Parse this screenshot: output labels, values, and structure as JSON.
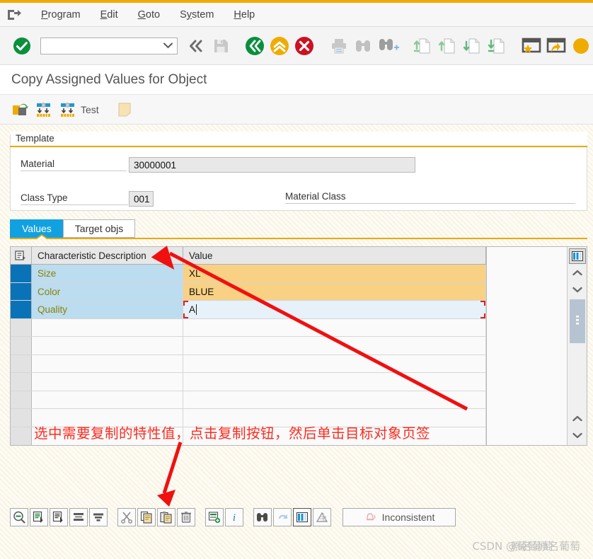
{
  "window": {
    "menu_items": [
      {
        "label": "Program",
        "accel": "P"
      },
      {
        "label": "Edit",
        "accel": "E"
      },
      {
        "label": "Goto",
        "accel": "G"
      },
      {
        "label": "System",
        "accel": "y"
      },
      {
        "label": "Help",
        "accel": "H"
      }
    ],
    "system_menu_icon": "system-menu-icon"
  },
  "toolbar": {
    "command_field_value": "",
    "command_field_placeholder": "",
    "buttons": [
      {
        "name": "enter-check-button",
        "icon": "green-check-icon",
        "title": "Enter"
      },
      {
        "name": "command-dropdown-button",
        "icon": "chevron-down-icon",
        "title": "Command field"
      },
      {
        "name": "back-double-button",
        "icon": "double-chevron-left-icon",
        "title": "Back"
      },
      {
        "name": "save-button",
        "icon": "floppy-disk-icon",
        "title": "Save"
      },
      {
        "name": "back-button",
        "icon": "green-back-icon",
        "title": "Back"
      },
      {
        "name": "exit-button",
        "icon": "yellow-up-icon",
        "title": "Exit"
      },
      {
        "name": "cancel-button",
        "icon": "red-cancel-icon",
        "title": "Cancel"
      },
      {
        "name": "print-button",
        "icon": "printer-icon",
        "title": "Print"
      },
      {
        "name": "find-button",
        "icon": "binoculars-icon",
        "title": "Find"
      },
      {
        "name": "find-next-button",
        "icon": "binoculars-plus-icon",
        "title": "Find Next"
      },
      {
        "name": "first-page-button",
        "icon": "page-first-icon",
        "title": "First Page"
      },
      {
        "name": "previous-page-button",
        "icon": "page-up-icon",
        "title": "Previous Page"
      },
      {
        "name": "next-page-button",
        "icon": "page-down-icon",
        "title": "Next Page"
      },
      {
        "name": "last-page-button",
        "icon": "page-last-icon",
        "title": "Last Page"
      },
      {
        "name": "create-favorite-button",
        "icon": "star-window-icon",
        "title": "Create Favorite"
      },
      {
        "name": "create-shortcut-button",
        "icon": "shortcut-window-icon",
        "title": "Create Shortcut"
      },
      {
        "name": "help-button",
        "icon": "help-icon",
        "title": "Help"
      }
    ]
  },
  "page": {
    "title": "Copy Assigned Values for Object"
  },
  "app_toolbar": {
    "buttons": [
      {
        "name": "copy-object-button",
        "icon": "copy-object-icon",
        "label": ""
      },
      {
        "name": "transfer-all-button",
        "icon": "transfer-down-icon",
        "label": ""
      },
      {
        "name": "test-button",
        "icon": "transfer-down-icon",
        "label": "Test"
      },
      {
        "name": "note-button",
        "icon": "note-icon",
        "label": ""
      }
    ]
  },
  "template_group": {
    "title": "Template",
    "material_label": "Material",
    "material_value": "30000001",
    "class_type_label": "Class Type",
    "class_type_value": "001",
    "material_class_label": "Material Class",
    "material_class_value": ""
  },
  "tabs": [
    {
      "label": "Values",
      "active": true,
      "name": "tab-values"
    },
    {
      "label": "Target objs",
      "active": false,
      "name": "tab-target-objs"
    }
  ],
  "grid": {
    "select_all_icon": "select-all-icon",
    "columns": [
      "Characteristic Description",
      "Value"
    ],
    "rows": [
      {
        "selected": true,
        "description": "Size",
        "value": "XL",
        "editing": false
      },
      {
        "selected": true,
        "description": "Color",
        "value": "BLUE",
        "editing": false
      },
      {
        "selected": true,
        "description": "Quality",
        "value": "A",
        "editing": true
      },
      {
        "selected": false,
        "description": "",
        "value": "",
        "editing": false
      },
      {
        "selected": false,
        "description": "",
        "value": "",
        "editing": false
      },
      {
        "selected": false,
        "description": "",
        "value": "",
        "editing": false
      },
      {
        "selected": false,
        "description": "",
        "value": "",
        "editing": false
      },
      {
        "selected": false,
        "description": "",
        "value": "",
        "editing": false
      },
      {
        "selected": false,
        "description": "",
        "value": "",
        "editing": false
      },
      {
        "selected": false,
        "description": "",
        "value": "",
        "editing": false
      }
    ],
    "config_icon": "grid-config-icon",
    "scroll_up_icon": "chevron-up-icon",
    "scroll_down_icon": "chevron-down-icon",
    "scroll_page_up_icon": "chevron-up-icon",
    "scroll_page_down_icon": "chevron-down-icon",
    "popup_icon": "value-help-popup-icon"
  },
  "annotation": {
    "text": "选中需要复制的特性值，点击复制按钮，然后单击目标对象页签",
    "color": "#ff2a1e"
  },
  "bottom_toolbar": {
    "buttons": [
      {
        "name": "display-filter-button",
        "icon": "search-magnifier-icon"
      },
      {
        "name": "assign-values-button",
        "icon": "list-arrow-icon"
      },
      {
        "name": "assign-values-alt-button",
        "icon": "list-arrow-alt-icon"
      },
      {
        "name": "compress-button",
        "icon": "compress-icon"
      },
      {
        "name": "sort-button",
        "icon": "sort-icon"
      },
      {
        "name": "cut-button",
        "icon": "scissors-icon"
      },
      {
        "name": "copy-button",
        "icon": "copy-icon"
      },
      {
        "name": "paste-button",
        "icon": "paste-icon"
      },
      {
        "name": "delete-button",
        "icon": "trash-icon"
      },
      {
        "name": "insert-row-button",
        "icon": "insert-row-icon"
      },
      {
        "name": "info-button",
        "icon": "info-icon"
      },
      {
        "name": "find-button",
        "icon": "binoculars-icon"
      },
      {
        "name": "undo-button",
        "icon": "undo-icon"
      },
      {
        "name": "table-view-button",
        "icon": "table-icon"
      },
      {
        "name": "chart-view-button",
        "icon": "chart-icon"
      }
    ],
    "status_label": "Inconsistent",
    "status_icon": "bell-icon"
  },
  "watermark": {
    "prefix": "CSDN @",
    "name_a": "葡萄原名葡萄",
    "name_b": "原名葡萄"
  },
  "colors": {
    "accent_gold": "#f0ab00",
    "tab_active": "#12a1e0",
    "row_selected_blue": "#0a73b8",
    "row_desc_bg": "#bcdcf0",
    "row_value_bg": "#f8d184",
    "annotation_red": "#ff2a1e"
  }
}
